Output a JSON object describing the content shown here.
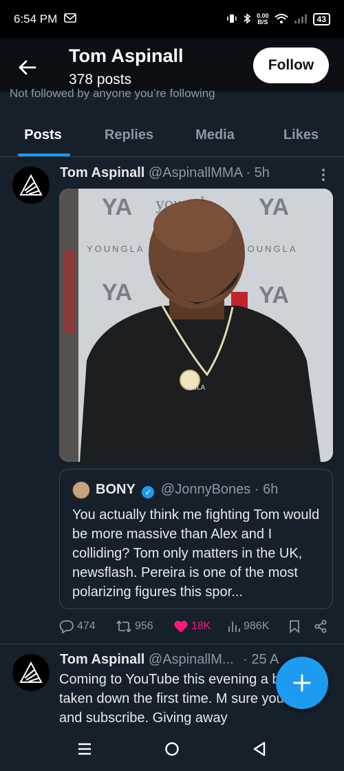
{
  "status_bar": {
    "time": "6:54 PM",
    "notification_icon": "mail-icon",
    "net_speed_value": "0.00",
    "net_speed_unit": "B/S",
    "battery": "43"
  },
  "header": {
    "title": "Tom Aspinall",
    "subtitle": "378 posts",
    "follow_label": "Follow",
    "follow_note": "Not followed by anyone you’re following"
  },
  "tabs": [
    {
      "label": "Posts",
      "active": true
    },
    {
      "label": "Replies",
      "active": false
    },
    {
      "label": "Media",
      "active": false
    },
    {
      "label": "Likes",
      "active": false
    }
  ],
  "tweet1": {
    "name": "Tom Aspinall",
    "handle": "@AspinallMMA · 5h",
    "media_labels": {
      "brand": "YOUNGLA",
      "banner": "youngla",
      "logo": "YA",
      "shirt": "NGLA"
    },
    "quote": {
      "name": "BONY",
      "handle": "@JonnyBones · 6h",
      "text": "You actually think me fighting Tom would be more massive than Alex and I colliding? Tom only matters in the UK, newsflash. Pereira is one of the most polarizing figures this spor..."
    },
    "stats": {
      "replies": "474",
      "reposts": "956",
      "likes": "18K",
      "views": "986K"
    }
  },
  "tweet2": {
    "name": "Tom Aspinall",
    "handle": "@AspinallM...",
    "time": "· 25 A",
    "text": "Coming to YouTube this evening a being taken down the first time. M sure you like and subscribe. Giving away"
  },
  "colors": {
    "background": "#15202b",
    "accent": "#1d9bf0",
    "like": "#f91880",
    "muted": "#8b98a5"
  }
}
